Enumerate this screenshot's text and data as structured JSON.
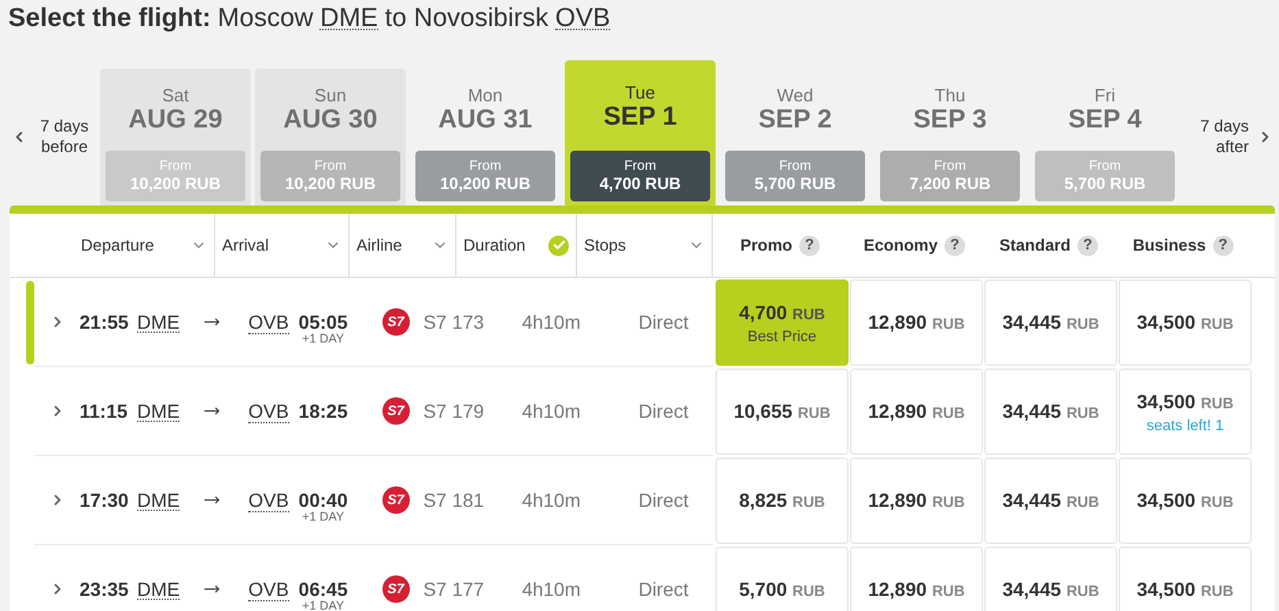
{
  "title": {
    "label": "Select the flight:",
    "text": "Moscow",
    "origin": "DME",
    "joiner": "to Novosibirsk",
    "destination": "OVB"
  },
  "date_nav": {
    "before": "7 days before",
    "after": "7 days after"
  },
  "days": [
    {
      "weekday": "Sat",
      "date": "AUG 29",
      "from": "From",
      "price": "10,200 RUB",
      "selected": false,
      "disabled": true,
      "color": "#c8c9ca"
    },
    {
      "weekday": "Sun",
      "date": "AUG 30",
      "from": "From",
      "price": "10,200 RUB",
      "selected": false,
      "disabled": true,
      "color": "#b4b6b8"
    },
    {
      "weekday": "Mon",
      "date": "AUG 31",
      "from": "From",
      "price": "10,200 RUB",
      "selected": false,
      "disabled": false,
      "color": "#9a9da0"
    },
    {
      "weekday": "Tue",
      "date": "SEP 1",
      "from": "From",
      "price": "4,700 RUB",
      "selected": true,
      "disabled": false,
      "color": "#404b52"
    },
    {
      "weekday": "Wed",
      "date": "SEP 2",
      "from": "From",
      "price": "5,700 RUB",
      "selected": false,
      "disabled": false,
      "color": "#9a9da0"
    },
    {
      "weekday": "Thu",
      "date": "SEP 3",
      "from": "From",
      "price": "7,200 RUB",
      "selected": false,
      "disabled": false,
      "color": "#abadaf"
    },
    {
      "weekday": "Fri",
      "date": "SEP 4",
      "from": "From",
      "price": "5,700 RUB",
      "selected": false,
      "disabled": false,
      "color": "#bdbfc1"
    }
  ],
  "columns": [
    {
      "label": "Departure",
      "sorted": false
    },
    {
      "label": "Arrival",
      "sorted": false
    },
    {
      "label": "Airline",
      "sorted": false
    },
    {
      "label": "Duration",
      "sorted": true
    },
    {
      "label": "Stops",
      "sorted": false
    }
  ],
  "fare_columns": [
    {
      "label": "Promo",
      "help": "?"
    },
    {
      "label": "Economy",
      "help": "?"
    },
    {
      "label": "Standard",
      "help": "?"
    },
    {
      "label": "Business",
      "help": "?"
    }
  ],
  "rows": [
    {
      "selected": true,
      "departure": "21:55",
      "from": "DME",
      "to": "OVB",
      "arrival": "05:05",
      "next_day": "+1 DAY",
      "logo": "S7",
      "flight": "S7 173",
      "duration": "4h10m",
      "stops": "Direct",
      "fares": [
        {
          "amount": "4,700",
          "currency": "RUB",
          "best": true,
          "note": "Best Price",
          "kind": "label"
        },
        {
          "amount": "12,890",
          "currency": "RUB",
          "best": false
        },
        {
          "amount": "34,445",
          "currency": "RUB",
          "best": false
        },
        {
          "amount": "34,500",
          "currency": "RUB",
          "best": false
        }
      ]
    },
    {
      "selected": false,
      "departure": "11:15",
      "from": "DME",
      "to": "OVB",
      "arrival": "18:25",
      "logo": "S7",
      "flight": "S7 179",
      "duration": "4h10m",
      "stops": "Direct",
      "fares": [
        {
          "amount": "10,655",
          "currency": "RUB",
          "best": false
        },
        {
          "amount": "12,890",
          "currency": "RUB",
          "best": false
        },
        {
          "amount": "34,445",
          "currency": "RUB",
          "best": false
        },
        {
          "amount": "34,500",
          "currency": "RUB",
          "best": false,
          "note": "seats left! 1",
          "kind": "alert"
        }
      ]
    },
    {
      "selected": false,
      "departure": "17:30",
      "from": "DME",
      "to": "OVB",
      "arrival": "00:40",
      "next_day": "+1 DAY",
      "logo": "S7",
      "flight": "S7 181",
      "duration": "4h10m",
      "stops": "Direct",
      "fares": [
        {
          "amount": "8,825",
          "currency": "RUB",
          "best": false
        },
        {
          "amount": "12,890",
          "currency": "RUB",
          "best": false
        },
        {
          "amount": "34,445",
          "currency": "RUB",
          "best": false
        },
        {
          "amount": "34,500",
          "currency": "RUB",
          "best": false
        }
      ]
    },
    {
      "selected": false,
      "departure": "23:35",
      "from": "DME",
      "to": "OVB",
      "arrival": "06:45",
      "next_day": "+1 DAY",
      "logo": "S7",
      "flight": "S7 177",
      "duration": "4h10m",
      "stops": "Direct",
      "fares": [
        {
          "amount": "5,700",
          "currency": "RUB",
          "best": false
        },
        {
          "amount": "12,890",
          "currency": "RUB",
          "best": false
        },
        {
          "amount": "34,445",
          "currency": "RUB",
          "best": false
        },
        {
          "amount": "34,500",
          "currency": "RUB",
          "best": false
        }
      ]
    }
  ]
}
